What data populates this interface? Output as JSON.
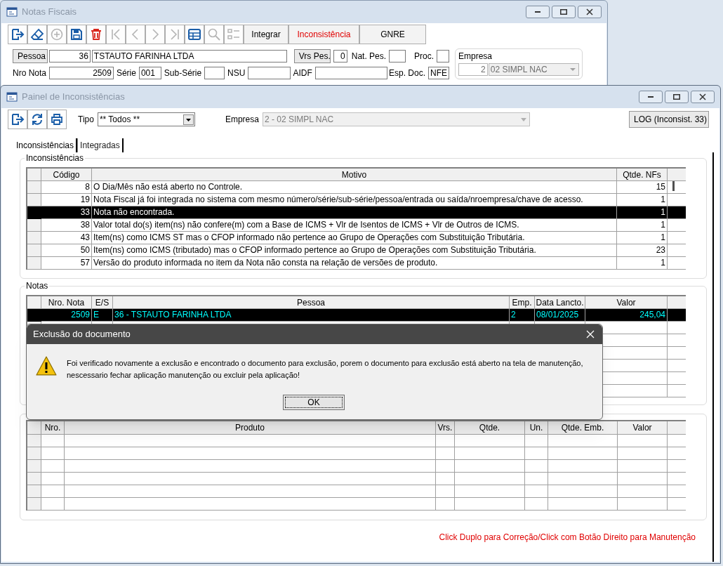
{
  "back_window": {
    "title": "Notas Fiscais",
    "toolbar": [
      {
        "kind": "exit",
        "disabled": false
      },
      {
        "kind": "eraser",
        "disabled": false
      },
      {
        "kind": "add",
        "disabled": true
      },
      {
        "kind": "save",
        "disabled": false
      },
      {
        "kind": "delete",
        "disabled": false
      },
      {
        "kind": "first",
        "disabled": true
      },
      {
        "kind": "prev",
        "disabled": true
      },
      {
        "kind": "next",
        "disabled": true
      },
      {
        "kind": "last",
        "disabled": true
      },
      {
        "kind": "grid",
        "disabled": false
      },
      {
        "kind": "search",
        "disabled": true
      },
      {
        "kind": "list",
        "disabled": true
      }
    ],
    "text_buttons": [
      {
        "label": "Integrar",
        "kind": "normal"
      },
      {
        "label": "Inconsistência",
        "kind": "alert"
      },
      {
        "label": "GNRE",
        "kind": "normal"
      }
    ],
    "pessoa_button": "Pessoa",
    "pessoa_code": "36",
    "pessoa_name": "TSTAUTO FARINHA LTDA",
    "vrs_pes_button": "Vrs Pes.",
    "vrs_pes": "0",
    "nat_pes_label": "Nat. Pes.",
    "proc_label": "Proc.",
    "nro_nota_label": "Nro Nota",
    "nro_nota": "2509",
    "serie_label": "Série",
    "serie": "001",
    "sub_serie_label": "Sub-Série",
    "nsu_label": "NSU",
    "aidf_label": "AIDF",
    "esp_doc_label": "Esp. Doc.",
    "esp_doc": "NFE",
    "empresa": {
      "label": "Empresa",
      "code": "2",
      "name": "02 SIMPL NAC",
      "disabled": true
    }
  },
  "front_window": {
    "title": "Painel de Inconsistências",
    "toolbar": [
      {
        "kind": "exit",
        "disabled": false
      },
      {
        "kind": "refresh",
        "disabled": false
      },
      {
        "kind": "print",
        "disabled": false
      }
    ],
    "tipo_label": "Tipo",
    "tipo_value": "** Todos **",
    "empresa_label": "Empresa",
    "empresa_value": "2 - 02 SIMPL NAC",
    "empresa_disabled": true,
    "log_button": "LOG (Inconsist. 33)",
    "tabs": [
      {
        "label": "Inconsistências",
        "selected": true
      },
      {
        "label": "Integradas",
        "selected": false
      }
    ],
    "inconsistencias": {
      "title": "Inconsistências",
      "columns": [
        "Código",
        "Motivo",
        "Qtde. NFs"
      ],
      "rows": [
        {
          "cells": [
            "8",
            "O Dia/Mês não está aberto no Controle.",
            "15"
          ],
          "selected": false
        },
        {
          "cells": [
            "19",
            "Nota Fiscal já foi integrada no sistema com mesmo número/série/sub-série/pessoa/entrada ou saída/nroempresa/chave de acesso.",
            "1"
          ],
          "selected": false
        },
        {
          "cells": [
            "33",
            "Nota não encontrada.",
            "1"
          ],
          "selected": true
        },
        {
          "cells": [
            "38",
            "Valor total do(s) item(ns) não confere(m) com a Base de ICMS + Vlr de Isentos de ICMS + Vlr de Outros de ICMS.",
            "1"
          ],
          "selected": false
        },
        {
          "cells": [
            "43",
            "Item(ns) como ICMS ST mas o CFOP informado não pertence ao Grupo de Operações com Substituição Tributária.",
            "1"
          ],
          "selected": false
        },
        {
          "cells": [
            "50",
            "Item(ns) como ICMS (tributado) mas o CFOP informado pertence ao Grupo de Operações com Substituição Tributária.",
            "23"
          ],
          "selected": false
        },
        {
          "cells": [
            "57",
            "Versão do produto informada no item da Nota não consta na relação de versões de produto.",
            "1"
          ],
          "selected": false
        }
      ]
    },
    "notas": {
      "title": "Notas",
      "columns": [
        "Nro. Nota",
        "E/S",
        "Pessoa",
        "Emp.",
        "Data Lancto.",
        "Valor"
      ],
      "rows": [
        {
          "cells": [
            "2509",
            "E",
            "36 - TSTAUTO FARINHA LTDA",
            "2",
            "08/01/2025",
            "245,04"
          ],
          "selected": true
        }
      ]
    },
    "itens": {
      "columns": [
        "Nro.",
        "Produto",
        "Vrs.",
        "Qtde.",
        "Un.",
        "Qtde. Emb.",
        "Valor"
      ]
    },
    "hint": "Click Duplo para Correção/Click com Botão Direito para Manutenção"
  },
  "dialog": {
    "title": "Exclusão do documento",
    "message": "Foi verificado novamente a exclusão e encontrado o documento para exclusão, porem o documento para exclusão está aberto na tela de manutenção, nescessario fechar aplicação manutenção ou excluir pela aplicação!",
    "ok_button": "OK"
  }
}
